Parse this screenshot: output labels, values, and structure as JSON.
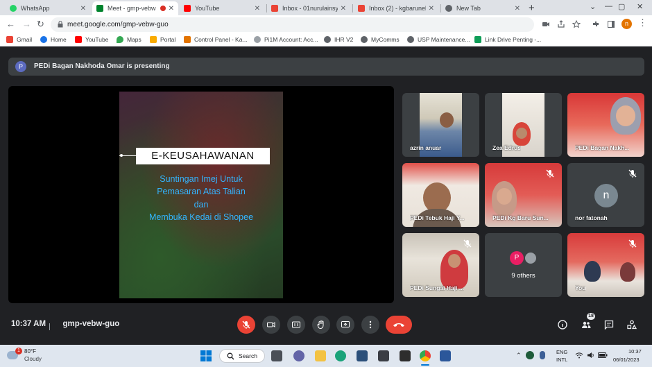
{
  "browser": {
    "tabs": [
      {
        "label": "WhatsApp",
        "color": "#25d366"
      },
      {
        "label": "Meet - gmp-vebw",
        "color": "#00832d"
      },
      {
        "label": "YouTube",
        "color": "#ff0000"
      },
      {
        "label": "Inbox - 01nurulainsya",
        "color": "#ea4335"
      },
      {
        "label": "Inbox (2) - kgbarunela",
        "color": "#ea4335"
      },
      {
        "label": "New Tab",
        "color": "#5f6368"
      }
    ],
    "url": "meet.google.com/gmp-vebw-guo",
    "profile_initial": "n",
    "bookmarks": [
      {
        "label": "Gmail",
        "color": "#ea4335"
      },
      {
        "label": "Home",
        "color": "#1a73e8"
      },
      {
        "label": "YouTube",
        "color": "#ff0000"
      },
      {
        "label": "Maps",
        "color": "#34a853"
      },
      {
        "label": "Portal",
        "color": "#f9ab00"
      },
      {
        "label": "Control Panel - Ka...",
        "color": "#e37400"
      },
      {
        "label": "Pi1M Account: Acc...",
        "color": "#9aa0a6"
      },
      {
        "label": "IHR V2",
        "color": "#5f6368"
      },
      {
        "label": "MyComms",
        "color": "#5f6368"
      },
      {
        "label": "USP Maintenance...",
        "color": "#5f6368"
      },
      {
        "label": "Link Drive Penting -...",
        "color": "#0f9d58"
      }
    ]
  },
  "meet": {
    "banner": {
      "avatar": "P",
      "text": "PEDi Bagan Nakhoda Omar is presenting"
    },
    "slide": {
      "title": "E-KEUSAHAWANAN",
      "lines": [
        "Suntingan Imej Untuk",
        "Pemasaran Atas Talian",
        "dan",
        "Membuka Kedai di Shopee"
      ]
    },
    "participants": [
      {
        "name": "azrin anuar"
      },
      {
        "name": "Zea Edrus"
      },
      {
        "name": "PEDi Bagan Nakh..."
      },
      {
        "name": "PEDi Tebuk Haji Y..."
      },
      {
        "name": "PEDi Kg Baru Sun..."
      },
      {
        "name": "nor fatonah",
        "avatar": "n"
      },
      {
        "name": "PEDi Sungai Haji ..."
      },
      {
        "name": "9 others",
        "avatar": "P"
      },
      {
        "name": "You"
      }
    ],
    "time": "10:37 AM",
    "meeting_code": "gmp-vebw-guo",
    "people_count": "18"
  },
  "taskbar": {
    "weather_badge": "1",
    "temperature": "80°F",
    "condition": "Cloudy",
    "search_label": "Search",
    "language": "ENG",
    "layout": "INTL",
    "clock_time": "10:37",
    "clock_date": "06/01/2023"
  }
}
